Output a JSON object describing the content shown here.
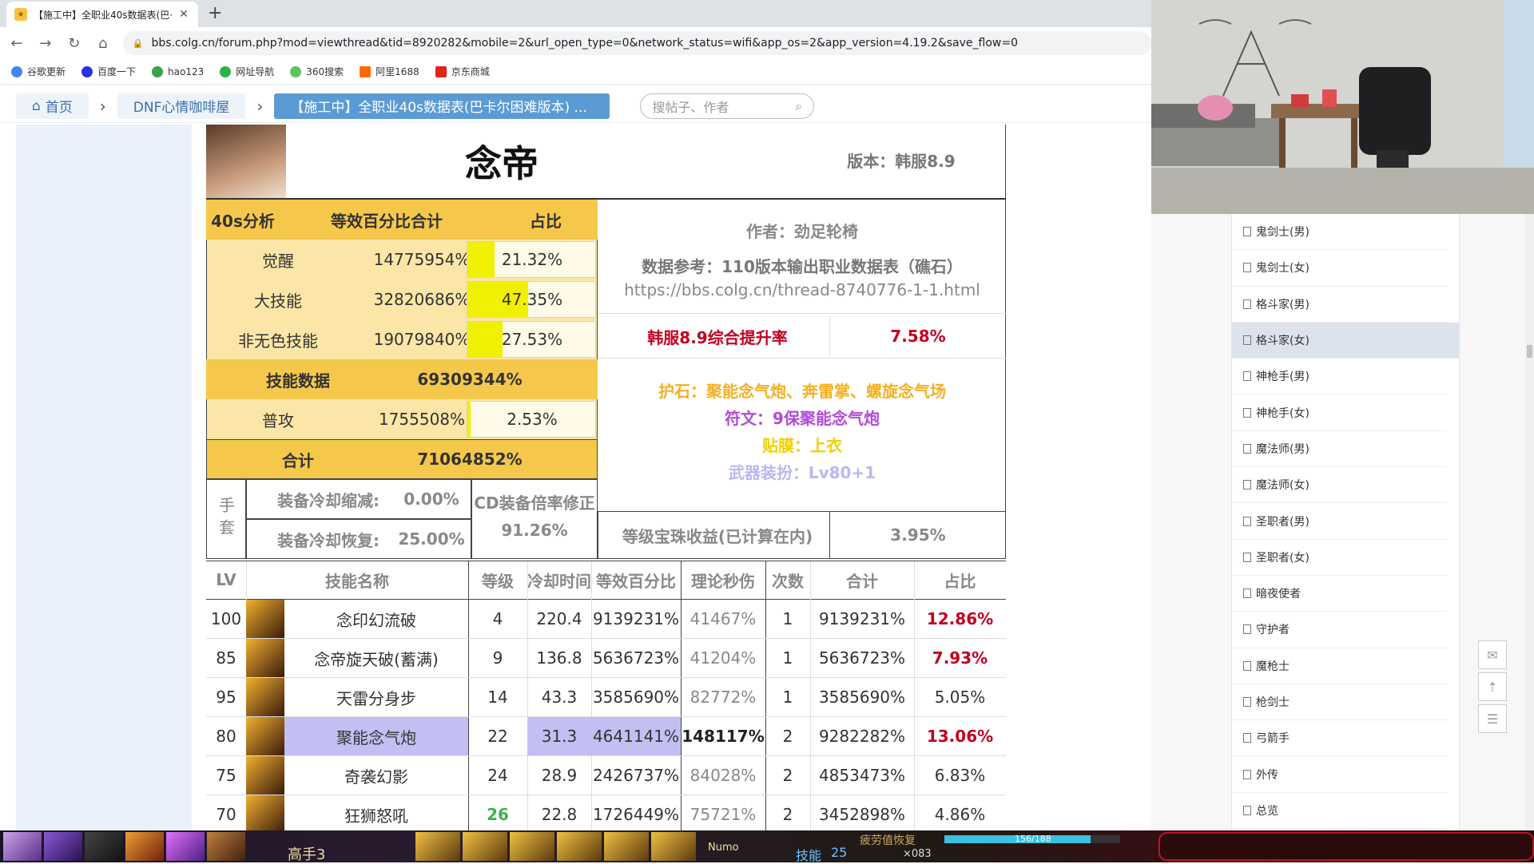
{
  "browser": {
    "tab_title": "【施工中】全职业40s数据表(巴·",
    "address": "bbs.colg.cn/forum.php?mod=viewthread&tid=8920282&mobile=2&url_open_type=0&network_status=wifi&app_os=2&app_version=4.19.2&save_flow=0",
    "bookmarks": [
      "谷歌更新",
      "百度一下",
      "hao123",
      "网址导航",
      "360搜索",
      "阿里1688",
      "京东商城"
    ]
  },
  "forum": {
    "home": "首页",
    "board": "DNF心情咖啡屋",
    "thread": "【施工中】全职业40s数据表(巴卡尔困难版本) ...",
    "search_placeholder": "搜帖子、作者"
  },
  "sheet": {
    "title": "念帝",
    "version": "版本：韩服8.9",
    "analysis": {
      "h1": "40s分析",
      "h2": "等效百分比合计",
      "h3": "占比",
      "rows": [
        {
          "name": "觉醒",
          "value": "14775954%",
          "pct": "21.32%",
          "fill": 0.2132
        },
        {
          "name": "大技能",
          "value": "32820686%",
          "pct": "47.35%",
          "fill": 0.4735
        },
        {
          "name": "非无色技能",
          "value": "19079840%",
          "pct": "27.53%",
          "fill": 0.2753
        }
      ],
      "skill_total_label": "技能数据",
      "skill_total": "69309344%",
      "normal": {
        "name": "普攻",
        "value": "1755508%",
        "pct": "2.53%",
        "fill": 0.0253
      },
      "sum_label": "合计",
      "sum": "71064852%"
    },
    "gloves": {
      "label": "手套",
      "cdr_label": "装备冷却缩减:",
      "cdr": "0.00%",
      "rec_label": "装备冷却恢复:",
      "rec": "25.00%",
      "cd_mod_label": "CD装备倍率修正",
      "cd_mod": "91.26%"
    },
    "info": {
      "author": "作者：劲足轮椅",
      "ref": "数据参考：110版本输出职业数据表（礁石）",
      "link": "https://bbs.colg.cn/thread-8740776-1-1.html",
      "uplift_label": "韩服8.9综合提升率",
      "uplift": "7.58%",
      "stone": "护石：聚能念气炮、奔雷掌、螺旋念气场",
      "rune": "符文：9保聚能念气炮",
      "emblem": "贴膜：上衣",
      "weapon": "武器装扮：Lv80+1",
      "gem_label": "等级宝珠收益(已计算在内)",
      "gem": "3.95%"
    },
    "skills": {
      "headers": [
        "LV",
        "技能名称",
        "等级",
        "冷却时间",
        "等效百分比",
        "理论秒伤",
        "次数",
        "合计",
        "占比"
      ],
      "rows": [
        {
          "lv": "100",
          "name": "念印幻流破",
          "level": "4",
          "cd": "220.4",
          "pct": "9139231%",
          "dps": "41467%",
          "times": "1",
          "total": "9139231%",
          "share": "12.86%",
          "hl": false
        },
        {
          "lv": "85",
          "name": "念帝旋天破(蓄满)",
          "level": "9",
          "cd": "136.8",
          "pct": "5636723%",
          "dps": "41204%",
          "times": "1",
          "total": "5636723%",
          "share": "7.93%",
          "hl": false
        },
        {
          "lv": "95",
          "name": "天雷分身步",
          "level": "14",
          "cd": "43.3",
          "pct": "3585690%",
          "dps": "82772%",
          "times": "1",
          "total": "3585690%",
          "share": "5.05%",
          "hl": false
        },
        {
          "lv": "80",
          "name": "聚能念气炮",
          "level": "22",
          "cd": "31.3",
          "pct": "4641141%",
          "dps": "148117%",
          "times": "2",
          "total": "9282282%",
          "share": "13.06%",
          "hl": true
        },
        {
          "lv": "75",
          "name": "奇袭幻影",
          "level": "24",
          "cd": "28.9",
          "pct": "2426737%",
          "dps": "84028%",
          "times": "2",
          "total": "4853473%",
          "share": "6.83%",
          "hl": false
        },
        {
          "lv": "70",
          "name": "狂狮怒吼",
          "level": "26",
          "cd": "22.8",
          "pct": "1726449%",
          "dps": "75721%",
          "times": "2",
          "total": "3452898%",
          "share": "4.86%",
          "hl": false
        }
      ]
    }
  },
  "sidebar": {
    "items": [
      "鬼剑士(男)",
      "鬼剑士(女)",
      "格斗家(男)",
      "格斗家(女)",
      "神枪手(男)",
      "神枪手(女)",
      "魔法师(男)",
      "魔法师(女)",
      "圣职者(男)",
      "圣职者(女)",
      "暗夜使者",
      "守护者",
      "魔枪士",
      "枪剑士",
      "弓箭手",
      "外传",
      "总览"
    ],
    "active_index": 3
  },
  "game": {
    "player": "高手3",
    "skill_label": "技能",
    "skill_count": "25",
    "hp": "156/188",
    "counter": "×083",
    "numo": "Numo",
    "status": "疲劳值恢复"
  },
  "colors": {
    "yellow_header": "#f5c84b",
    "yellow_row": "#fbe6a8",
    "bar": "#f0f000",
    "purple": "#c3bff3",
    "red": "#c00020",
    "green": "#3cb44b",
    "blue_link": "#3a6fb0"
  }
}
